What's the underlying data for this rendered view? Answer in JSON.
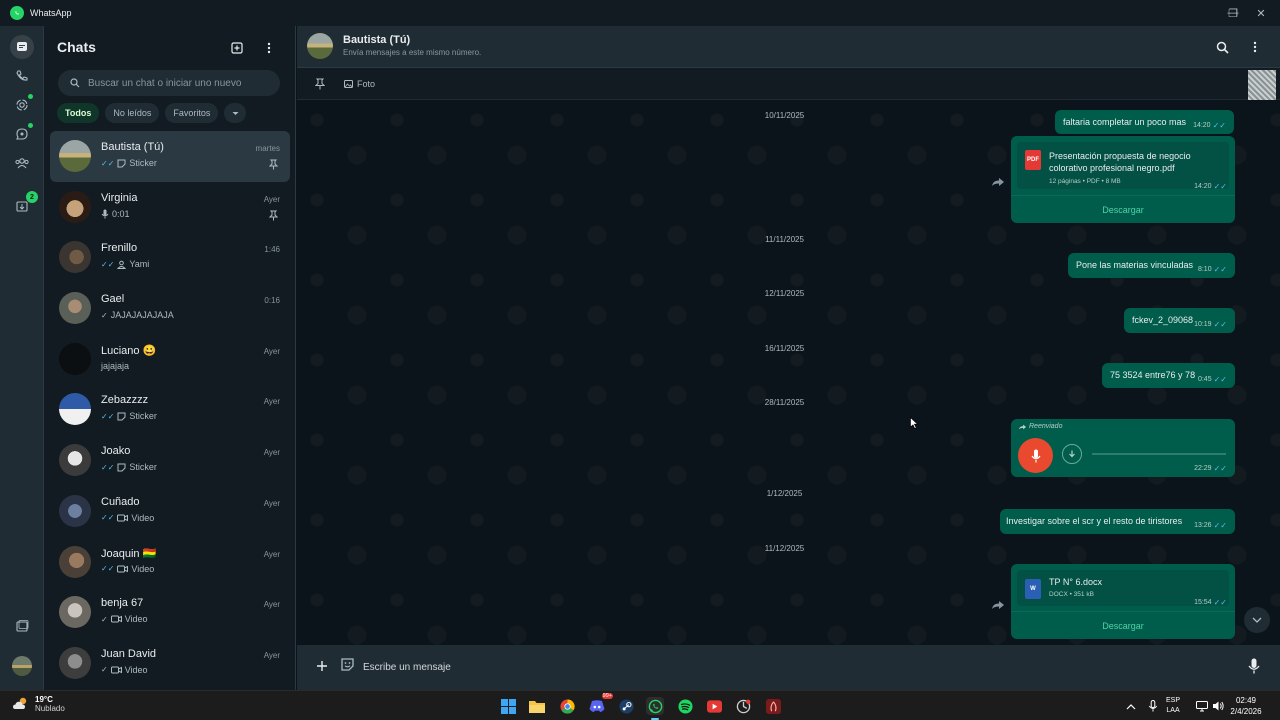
{
  "window": {
    "title": "WhatsApp",
    "minimize": "—",
    "restore": "❐",
    "close": "✕"
  },
  "sidebar": {
    "title": "Chats",
    "search_placeholder": "Buscar un chat o iniciar uno nuevo",
    "filters": [
      "Todos",
      "No leídos",
      "Favoritos"
    ],
    "rail_badge": "2",
    "chats": [
      {
        "name": "Bautista (Tú)",
        "time": "martes",
        "preview": "Sticker",
        "pinned": true
      },
      {
        "name": "Virginia",
        "time": "Ayer",
        "preview": "0:01",
        "pinned": true
      },
      {
        "name": "Frenillo",
        "time": "1:46",
        "preview": "Yami",
        "pinned": false
      },
      {
        "name": "Gael",
        "time": "0:16",
        "preview": "JAJAJAJAJAJA",
        "pinned": false
      },
      {
        "name": "Luciano 😀",
        "time": "Ayer",
        "preview": "jajajaja",
        "pinned": false
      },
      {
        "name": "Zebazzzz",
        "time": "Ayer",
        "preview": "Sticker",
        "pinned": false
      },
      {
        "name": "Joako",
        "time": "Ayer",
        "preview": "Sticker",
        "pinned": false
      },
      {
        "name": "Cuñado",
        "time": "Ayer",
        "preview": "Video",
        "pinned": false
      },
      {
        "name": "Joaquin 🇧🇴",
        "time": "Ayer",
        "preview": "Video",
        "pinned": false
      },
      {
        "name": "benja 67",
        "time": "Ayer",
        "preview": "Video",
        "pinned": false
      },
      {
        "name": "Juan David",
        "time": "Ayer",
        "preview": "Video",
        "pinned": false
      }
    ]
  },
  "chat": {
    "name": "Bautista (Tú)",
    "subtitle": "Envía mensajes a este mismo número.",
    "pinned_label": "Foto",
    "composer_placeholder": "Escribe un mensaje",
    "dates": [
      "10/11/2025",
      "11/11/2025",
      "12/11/2025",
      "16/11/2025",
      "28/11/2025",
      "1/12/2025",
      "11/12/2025"
    ],
    "messages": {
      "m1": {
        "text": "faltaria completar un poco mas",
        "time": "14:20"
      },
      "m2": {
        "file": "Presentación propuesta de negocio colorativo profesional negro.pdf",
        "info": "12 páginas • PDF • 8 MB",
        "time": "14:20",
        "icon": "PDF",
        "action": "Descargar"
      },
      "m3": {
        "text": "Pone las materias vinculadas",
        "time": "8:10"
      },
      "m4": {
        "text": "fckev_2_09068",
        "time": "10:19"
      },
      "m5": {
        "text": "75 3524 entre76 y 78",
        "time": "0:45"
      },
      "m6": {
        "label": "Reenviado",
        "time": "22:29"
      },
      "m7": {
        "text": "Investigar sobre el scr y el resto de tiristores",
        "time": "13:26"
      },
      "m8": {
        "file": "TP N° 6.docx",
        "info": "DOCX • 351 kB",
        "time": "15:54",
        "icon": "W",
        "action": "Descargar"
      }
    }
  },
  "taskbar": {
    "temperature": "19°C",
    "weather": "Nublado",
    "lang1": "ESP",
    "lang2": "LAA",
    "time": "02:49",
    "date": "2/4/2026",
    "discord_badge": "99+"
  },
  "colors": {
    "accent": "#25d366",
    "bubble_out": "#005c4b",
    "header": "#202c33",
    "background": "#0b141a",
    "read_tick": "#53bdeb"
  }
}
